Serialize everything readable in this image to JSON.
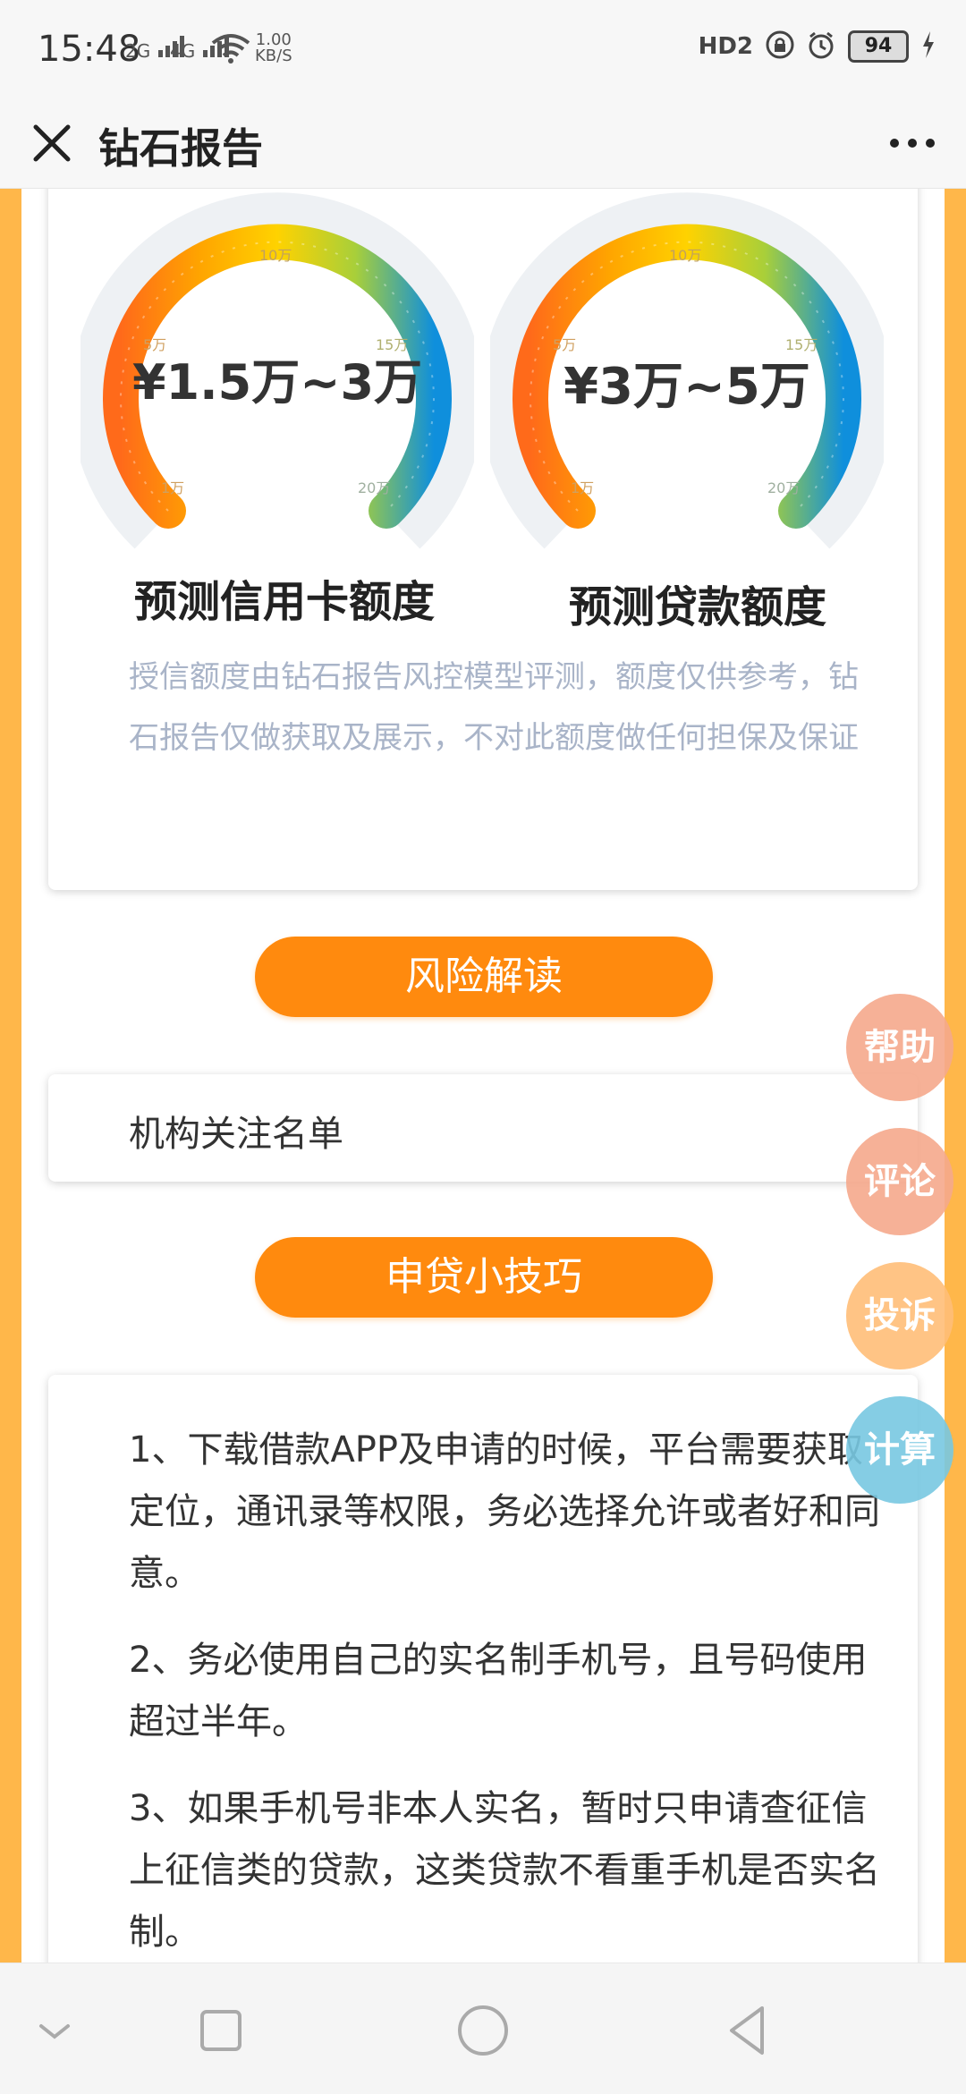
{
  "status_bar": {
    "time": "15:48",
    "signal1": "2G",
    "signal2": "4G",
    "net_speed_value": "1.00",
    "net_speed_unit": "KB/S",
    "hd_label": "HD2",
    "battery": "94"
  },
  "app_bar": {
    "title": "钻石报告",
    "close_icon": "close-icon",
    "more_icon": "more-icon"
  },
  "gauges": [
    {
      "value_text": "¥1.5万~3万",
      "label": "预测信用卡额度",
      "ticks": [
        "1万",
        "5万",
        "10万",
        "15万",
        "20万"
      ]
    },
    {
      "value_text": "¥3万~5万",
      "label": "预测贷款额度",
      "ticks": [
        "1万",
        "5万",
        "10万",
        "15万",
        "20万"
      ]
    }
  ],
  "credit_note": "授信额度由钻石报告风控模型评测，额度仅供参考，钻石报告仅做获取及展示，不对此额度做任何担保及保证",
  "risk_button": "风险解读",
  "institution_item": "机构关注名单",
  "tips_button": "申贷小技巧",
  "tips": [
    "1、下载借款APP及申请的时候，平台需要获取定位，通讯录等权限，务必选择允许或者好和同意。",
    "2、务必使用自己的实名制手机号，且号码使用超过半年。",
    "3、如果手机号非本人实名，暂时只申请查征信上征信类的贷款，这类贷款不看重手机是否实名制。"
  ],
  "float_buttons": [
    "帮助",
    "评论",
    "投诉",
    "计算"
  ],
  "colors": {
    "accent_orange": "#ff8a0e",
    "side_bar": "#ffb74a",
    "note_text": "#a9b4c8"
  }
}
